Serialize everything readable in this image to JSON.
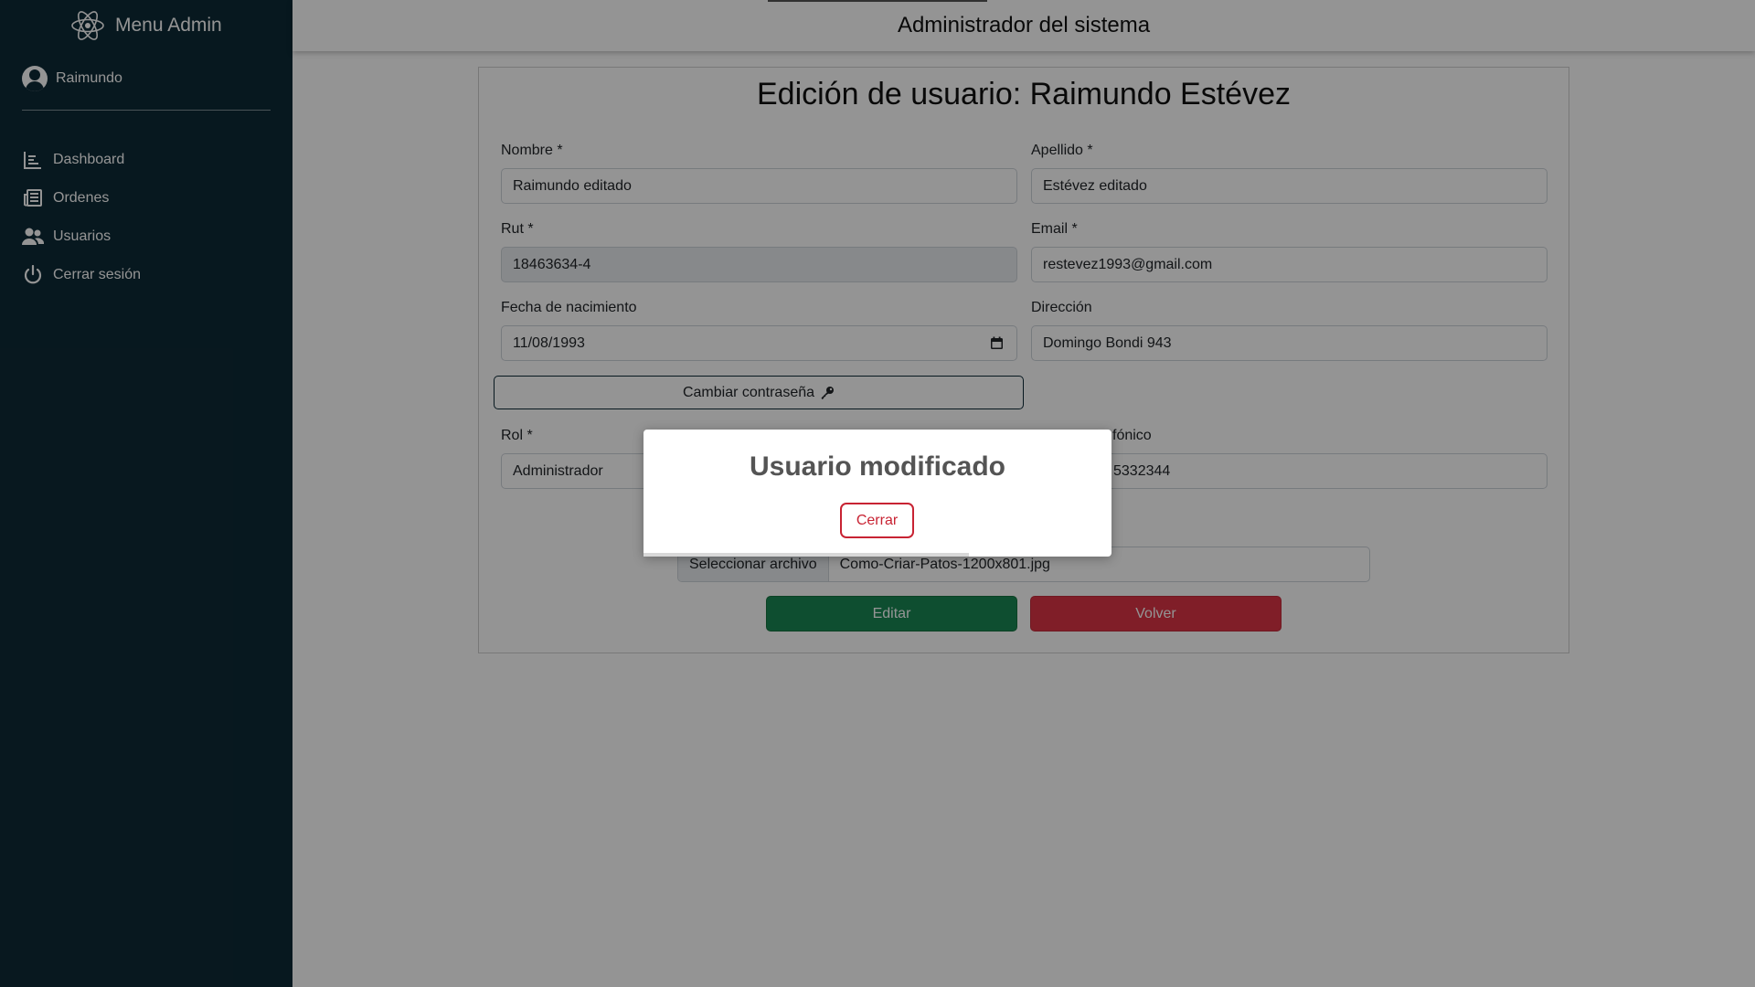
{
  "sidebar": {
    "brand": "Menu Admin",
    "user": "Raimundo",
    "items": [
      {
        "label": "Dashboard",
        "icon": "chart-bar-icon"
      },
      {
        "label": "Ordenes",
        "icon": "newspaper-icon"
      },
      {
        "label": "Usuarios",
        "icon": "users-icon"
      },
      {
        "label": "Cerrar sesión",
        "icon": "power-icon"
      }
    ],
    "colors": {
      "background": "#0d2a36"
    }
  },
  "header": {
    "title": "Administrador del sistema"
  },
  "form": {
    "title": "Edición de usuario: Raimundo Estévez",
    "nombre": {
      "label": "Nombre *",
      "value": "Raimundo editado"
    },
    "apellido": {
      "label": "Apellido *",
      "value": "Estévez editado"
    },
    "rut": {
      "label": "Rut *",
      "value": "18463634-4"
    },
    "email": {
      "label": "Email *",
      "value": "restevez1993@gmail.com"
    },
    "fecha": {
      "label": "Fecha de nacimiento",
      "value": "11/08/1993"
    },
    "direccion": {
      "label": "Dirección",
      "value": "Domingo Bondi 943"
    },
    "password_button": "Cambiar contraseña",
    "rol": {
      "label": "Rol *",
      "value": "Administrador"
    },
    "telefono": {
      "label": "fónico",
      "value": "5332344"
    },
    "file": {
      "button": "Seleccionar archivo",
      "name": "Como-Criar-Patos-1200x801.jpg"
    },
    "edit_button": "Editar",
    "back_button": "Volver"
  },
  "modal": {
    "title": "Usuario modificado",
    "close_button": "Cerrar"
  }
}
